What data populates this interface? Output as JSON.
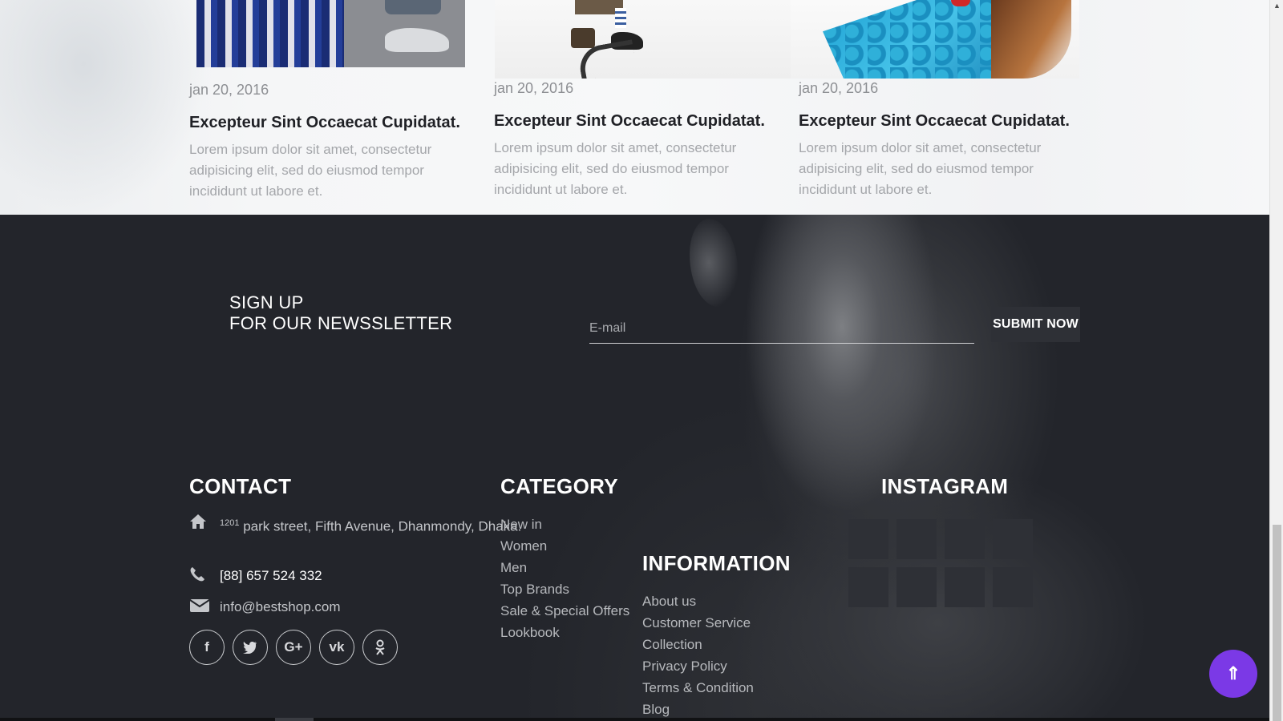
{
  "blog": {
    "cards": [
      {
        "date": "jan 20, 2016",
        "title": "Excepteur Sint Occaecat Cupidatat.",
        "text": "Lorem ipsum dolor sit amet, consectetur adipisicing elit, sed do eiusmod tempor incididunt ut labore et."
      },
      {
        "date": "jan 20, 2016",
        "title": "Excepteur Sint Occaecat Cupidatat.",
        "text": "Lorem ipsum dolor sit amet, consectetur adipisicing elit, sed do eiusmod tempor incididunt ut labore et."
      },
      {
        "date": "jan 20, 2016",
        "title": "Excepteur Sint Occaecat Cupidatat.",
        "text": "Lorem ipsum dolor sit amet, consectetur adipisicing elit, sed do eiusmod tempor incididunt ut labore et."
      }
    ]
  },
  "newsletter": {
    "line1": "SIGN UP",
    "line2": "FOR OUR NEWSSLETTER",
    "email_placeholder": "E-mail",
    "submit_label": "SUBMIT NOW"
  },
  "contact": {
    "title": "CONTACT",
    "address_sup": "1201",
    "address": " park street, Fifth Avenue, Dhanmondy, Dhaka.",
    "phone": "[88] 657 524 332",
    "email": "info@bestshop.com",
    "socials": [
      {
        "name": "facebook-icon",
        "glyph": "f"
      },
      {
        "name": "twitter-icon",
        "glyph": "🐦"
      },
      {
        "name": "google-plus-icon",
        "glyph": "G+"
      },
      {
        "name": "vk-icon",
        "glyph": "vk"
      },
      {
        "name": "odnoklassniki-icon",
        "glyph": "ok"
      }
    ]
  },
  "category": {
    "title": "CATEGORY",
    "items": [
      "New in",
      "Women",
      "Men",
      "Top Brands",
      "Sale & Special Offers",
      "Lookbook"
    ]
  },
  "information": {
    "title": "INFORMATION",
    "items": [
      "About us",
      "Customer Service",
      "Collection",
      "Privacy Policy",
      "Terms & Condition",
      "Blog"
    ]
  },
  "instagram": {
    "title": "INSTAGRAM"
  },
  "back_to_top": {
    "glyph": "⇑",
    "color": "#7b39e6"
  },
  "scrollbar": {
    "up_arrow": "▲"
  }
}
